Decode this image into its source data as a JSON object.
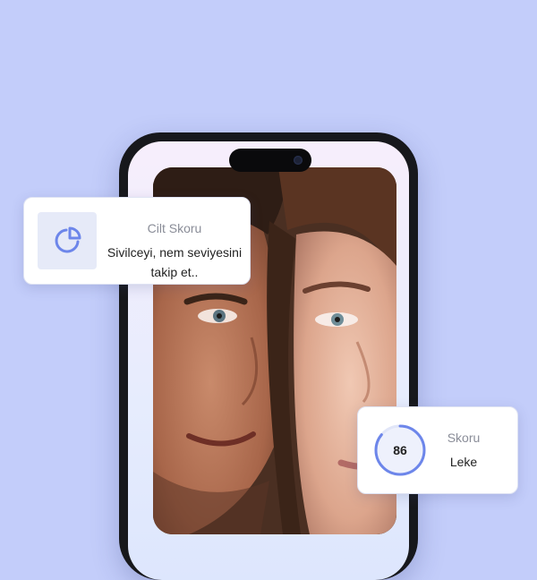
{
  "colors": {
    "background": "#c3cdfa",
    "accent": "#6d86ea",
    "card": "#ffffff",
    "icon_tile": "#e6eaf8"
  },
  "phone": {
    "camera": "front-camera-icon",
    "photo": "couple-face-photo"
  },
  "skin_card": {
    "icon": "pie-chart-icon",
    "title": "Cilt Skoru",
    "description": "Sivilceyi, nem seviyesini takip et.."
  },
  "score_card": {
    "value": "86",
    "progress_percent": 86,
    "title": "Skoru",
    "subtitle": "Leke"
  }
}
